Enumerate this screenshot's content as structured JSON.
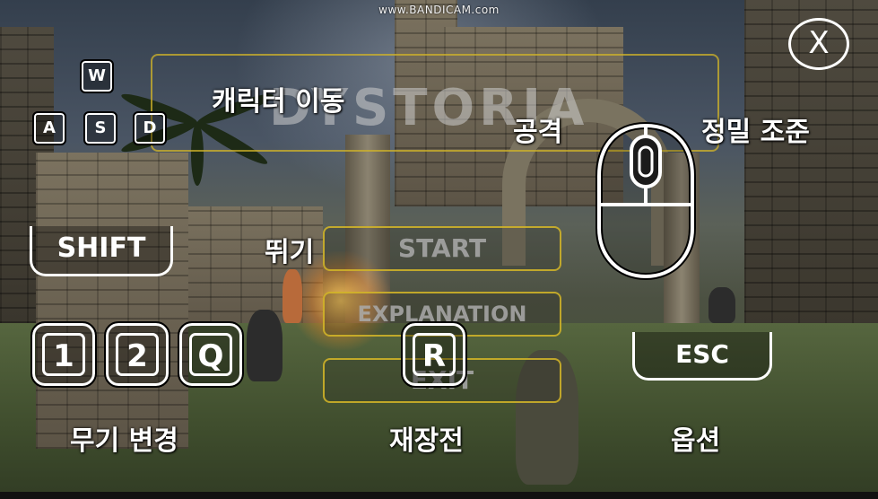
{
  "watermark": "www.BANDICAM.com",
  "game": {
    "logo_text": "DYSTORIA"
  },
  "menu": {
    "start": "START",
    "explanation": "EXPLANATION",
    "exit": "EXIT"
  },
  "close": {
    "label": "X"
  },
  "controls": {
    "move": {
      "keys": [
        "W",
        "A",
        "S",
        "D"
      ],
      "label": "캐릭터 이동"
    },
    "attack": {
      "label": "공격"
    },
    "aim": {
      "label": "정밀 조준"
    },
    "jump": {
      "key": "SHIFT",
      "label": "뛰기"
    },
    "weapon": {
      "keys": [
        "1",
        "2",
        "Q"
      ],
      "label": "무기 변경"
    },
    "reload": {
      "key": "R",
      "label": "재장전"
    },
    "options": {
      "key": "ESC",
      "label": "옵션"
    }
  },
  "icons": [
    "close-icon",
    "mouse-icon"
  ],
  "colors": {
    "overlay": "#ffffff",
    "menu_border": "#d7b928"
  }
}
